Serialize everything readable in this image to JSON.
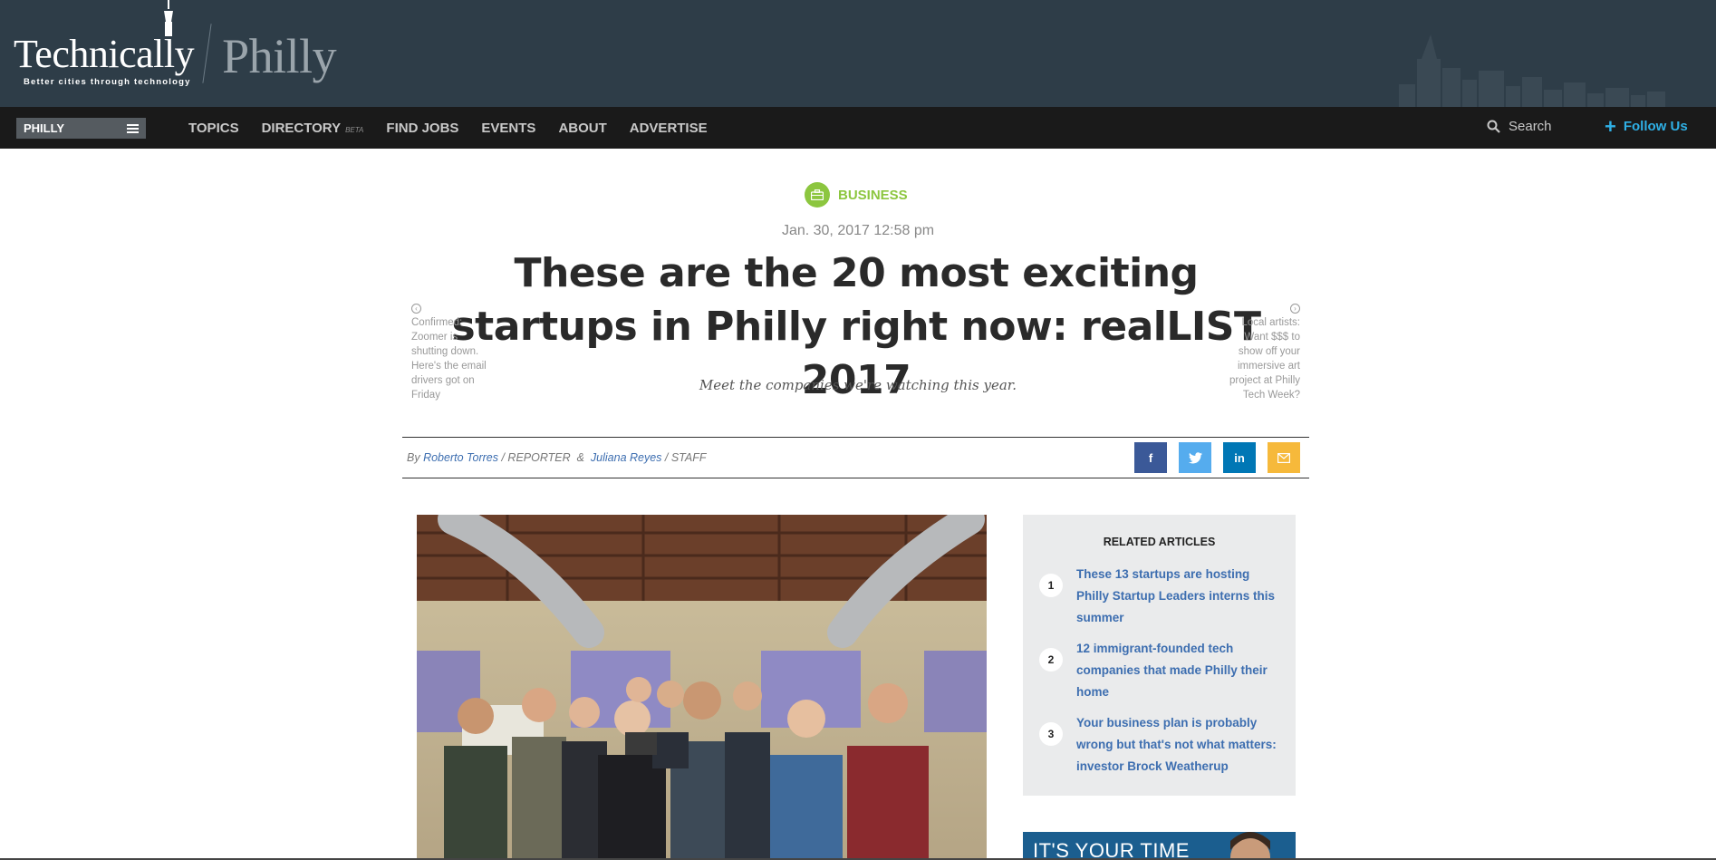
{
  "site": {
    "brand": "Technically",
    "tagline": "Better cities through technology",
    "city": "Philly"
  },
  "nav": {
    "city_select": "PHILLY",
    "links": [
      "TOPICS",
      "DIRECTORY",
      "FIND JOBS",
      "EVENTS",
      "ABOUT",
      "ADVERTISE"
    ],
    "directory_badge": "BETA",
    "search_label": "Search",
    "follow_label": "Follow Us"
  },
  "article": {
    "category": "BUSINESS",
    "date": "Jan. 30, 2017 12:58 pm",
    "headline": "These are the 20 most exciting startups in Philly right now: realLIST 2017",
    "dek": "Meet the companies we're watching this year.",
    "prev_story": "Confirmed: Zoomer is shutting down. Here's the email drivers got on Friday",
    "next_story": "Local artists: Want $$$ to show off your immersive art project at Philly Tech Week?",
    "byline": {
      "prefix": "By",
      "author1": "Roberto Torres",
      "role1": "REPORTER",
      "joiner": "&",
      "author2": "Juliana Reyes",
      "role2": "STAFF"
    },
    "share": {
      "facebook": "f",
      "linkedin": "in"
    }
  },
  "related": {
    "title": "RELATED ARTICLES",
    "items": [
      {
        "num": "1",
        "title": "These 13 startups are hosting Philly Startup Leaders interns this summer"
      },
      {
        "num": "2",
        "title": "12 immigrant-founded tech companies that made Philly their home"
      },
      {
        "num": "3",
        "title": "Your business plan is probably wrong but that's not what matters: investor Brock Weatherup"
      }
    ]
  },
  "ad": {
    "text": "IT'S YOUR TIME"
  },
  "colors": {
    "banner": "#2e3d48",
    "navbar": "#1a1a1a",
    "accent_green": "#8cc63f",
    "link_blue": "#3d6eb0",
    "follow_blue": "#2fb0e6"
  }
}
